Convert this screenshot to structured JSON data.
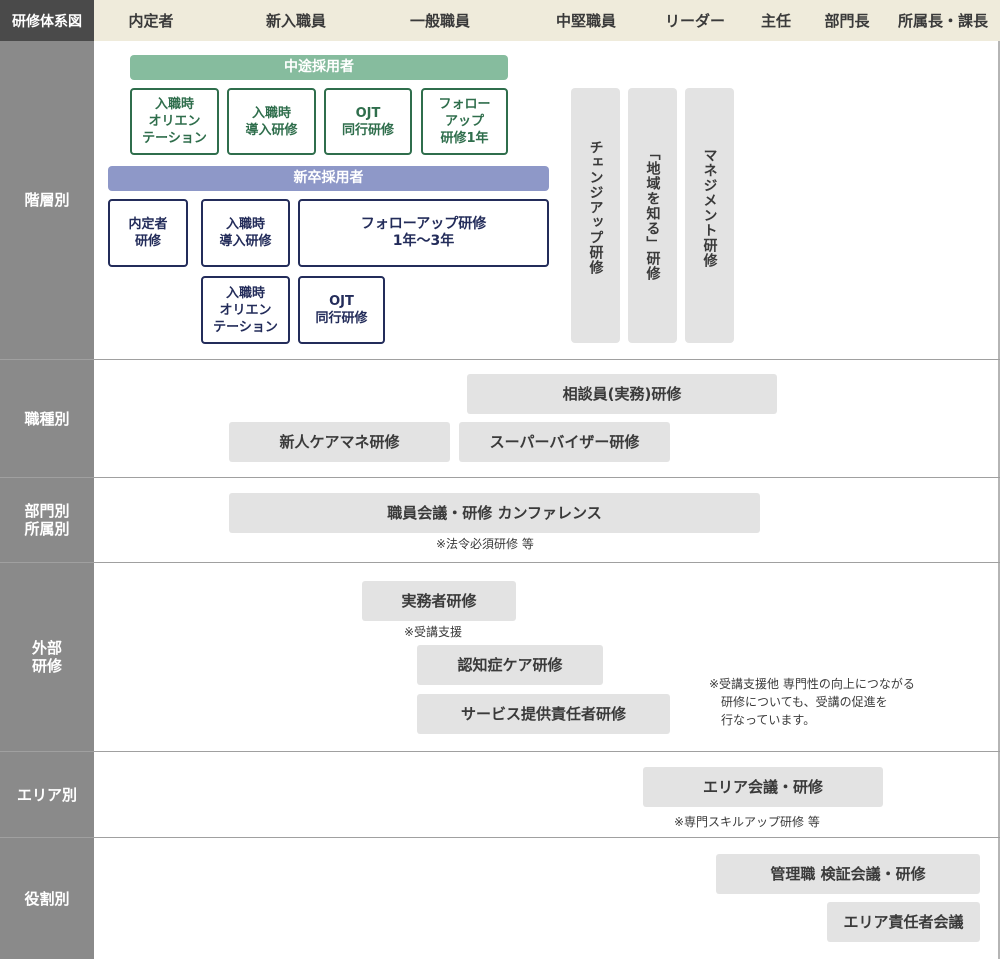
{
  "header": {
    "corner": "研修体系図",
    "columns": [
      "内定者",
      "新入職員",
      "一般職員",
      "中堅職員",
      "リーダー",
      "主任",
      "部門長",
      "所属長・課長"
    ]
  },
  "rows": [
    {
      "label": "階層別"
    },
    {
      "label": "職種別"
    },
    {
      "label": "部門別\n所属別"
    },
    {
      "label": "外部\n研修"
    },
    {
      "label": "エリア別"
    },
    {
      "label": "役割別"
    }
  ],
  "hierarchy": {
    "midcareer_title": "中途採用者",
    "midcareer_boxes": [
      "入職時\nオリエン\nテーション",
      "入職時\n導入研修",
      "OJT\n同行研修",
      "フォロー\nアップ\n研修1年"
    ],
    "newgrad_title": "新卒採用者",
    "newgrad_boxes": [
      "内定者\n研修",
      "入職時\n導入研修",
      "フォローアップ研修\n1年〜3年",
      "入職時\nオリエン\nテーション",
      "OJT\n同行研修"
    ],
    "vertical": [
      "チェンジアップ研修",
      "「地域を知る」研修",
      "マネジメント研修"
    ]
  },
  "job_type": [
    "相談員(実務)研修",
    "新人ケアマネ研修",
    "スーパーバイザー研修"
  ],
  "dept": {
    "box": "職員会議・研修 カンファレンス",
    "note": "※法令必須研修 等"
  },
  "external": {
    "boxes": [
      "実務者研修",
      "認知症ケア研修",
      "サービス提供責任者研修"
    ],
    "note1": "※受講支援",
    "note2": "※受講支援他 専門性の向上につながる\n　研修についても、受講の促進を\n　行なっています。"
  },
  "area": {
    "box": "エリア会議・研修",
    "note": "※専門スキルアップ研修 等"
  },
  "role": [
    "管理職 検証会議・研修",
    "エリア責任者会議"
  ]
}
